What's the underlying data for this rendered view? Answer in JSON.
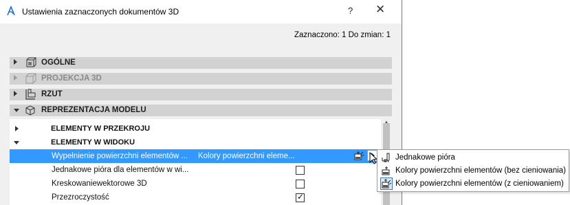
{
  "window": {
    "title": "Ustawienia zaznaczonych dokumentów 3D",
    "help_label": "?",
    "close_label": "✕"
  },
  "status": {
    "text": "Zaznaczono: 1 Do zmian: 1"
  },
  "panels": [
    {
      "label": "OGÓLNE",
      "icon": "general-settings-icon",
      "expanded": false,
      "enabled": true
    },
    {
      "label": "PROJEKCJA 3D",
      "icon": "3d-projection-icon",
      "expanded": false,
      "enabled": false
    },
    {
      "label": "RZUT",
      "icon": "floor-plan-icon",
      "expanded": false,
      "enabled": true
    },
    {
      "label": "REPREZENTACJA MODELU",
      "icon": "model-cube-icon",
      "expanded": true,
      "enabled": true
    }
  ],
  "tree": {
    "groups": [
      {
        "label": "ELEMENTY W PRZEKROJU",
        "expanded": false
      },
      {
        "label": "ELEMENTY W WIDOKU",
        "expanded": true
      }
    ],
    "rows": [
      {
        "name": "Wypełnienie powierzchni elementów ...",
        "value": "Kolory powierzchni eleme...",
        "selected": true
      },
      {
        "name": "Jednakowe pióra dla elementów w wi...",
        "checked": false
      },
      {
        "name": "Kreskowaniewektorowe 3D",
        "checked": false
      },
      {
        "name": "Przezroczystość",
        "checked": true
      }
    ]
  },
  "popup_menu": {
    "items": [
      {
        "label": "Jednakowe pióra",
        "icon": "uniform-pen-icon",
        "checked": false
      },
      {
        "label": "Kolory powierzchni elementów (bez cieniowania)",
        "icon": "surface-colors-icon",
        "checked": false
      },
      {
        "label": "Kolory powierzchni elementów (z cieniowaniem)",
        "icon": "shaded-surface-icon",
        "checked": true
      }
    ]
  },
  "colors": {
    "selection": "#3399ff",
    "panel_header": "#d2d2d2",
    "dialog_bg": "#f0f0f0"
  }
}
